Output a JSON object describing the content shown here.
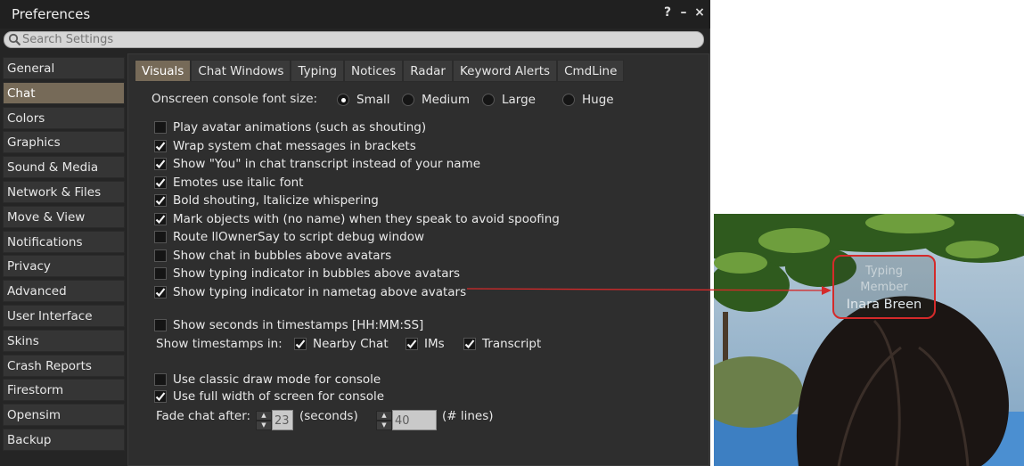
{
  "window": {
    "title": "Preferences",
    "help_label": "?",
    "minimize_label": "–",
    "close_label": "×"
  },
  "search": {
    "placeholder": "Search Settings"
  },
  "sidebar": {
    "items": [
      {
        "label": "General"
      },
      {
        "label": "Chat",
        "active": true
      },
      {
        "label": "Colors"
      },
      {
        "label": "Graphics"
      },
      {
        "label": "Sound & Media"
      },
      {
        "label": "Network & Files"
      },
      {
        "label": "Move & View"
      },
      {
        "label": "Notifications"
      },
      {
        "label": "Privacy"
      },
      {
        "label": "Advanced"
      },
      {
        "label": "User Interface"
      },
      {
        "label": "Skins"
      },
      {
        "label": "Crash Reports"
      },
      {
        "label": "Firestorm"
      },
      {
        "label": "Opensim"
      },
      {
        "label": "Backup"
      }
    ]
  },
  "tabs": [
    {
      "label": "Visuals",
      "active": true
    },
    {
      "label": "Chat Windows"
    },
    {
      "label": "Typing"
    },
    {
      "label": "Notices"
    },
    {
      "label": "Radar"
    },
    {
      "label": "Keyword Alerts"
    },
    {
      "label": "CmdLine"
    }
  ],
  "font_size": {
    "label": "Onscreen console font size:",
    "options": [
      {
        "label": "Small",
        "selected": true
      },
      {
        "label": "Medium",
        "selected": false
      },
      {
        "label": "Large",
        "selected": false
      },
      {
        "label": "Huge",
        "selected": false
      }
    ]
  },
  "options": [
    {
      "label": "Play avatar animations (such as shouting)",
      "checked": false
    },
    {
      "label": "Wrap system chat messages in brackets",
      "checked": true
    },
    {
      "label": "Show \"You\" in chat transcript instead of your name",
      "checked": true
    },
    {
      "label": "Emotes use italic font",
      "checked": true
    },
    {
      "label": "Bold shouting, Italicize whispering",
      "checked": true
    },
    {
      "label": "Mark objects with (no name) when they speak to avoid spoofing",
      "checked": true
    },
    {
      "label": "Route llOwnerSay to script debug window",
      "checked": false
    },
    {
      "label": "Show chat in bubbles above avatars",
      "checked": false
    },
    {
      "label": "Show typing indicator in bubbles above avatars",
      "checked": false
    },
    {
      "label": "Show typing indicator in nametag above avatars",
      "checked": true
    }
  ],
  "timestamps": {
    "seconds": {
      "label": "Show seconds in timestamps [HH:MM:SS]",
      "checked": false
    },
    "show_in_label": "Show timestamps in:",
    "targets": [
      {
        "label": "Nearby Chat",
        "checked": true
      },
      {
        "label": "IMs",
        "checked": true
      },
      {
        "label": "Transcript",
        "checked": true
      }
    ]
  },
  "console": {
    "classic": {
      "label": "Use classic draw mode for console",
      "checked": false
    },
    "full_width": {
      "label": "Use full width of screen for console",
      "checked": true
    },
    "fade_label": "Fade chat after:",
    "fade_seconds": "23",
    "seconds_unit": "(seconds)",
    "fade_lines": "40",
    "lines_unit": "(# lines)"
  },
  "nametag": {
    "line1": "Typing",
    "line2": "Member",
    "line3": "Inara Breen"
  },
  "colors": {
    "accent": "#766a58",
    "annotation": "#d42a2a"
  }
}
